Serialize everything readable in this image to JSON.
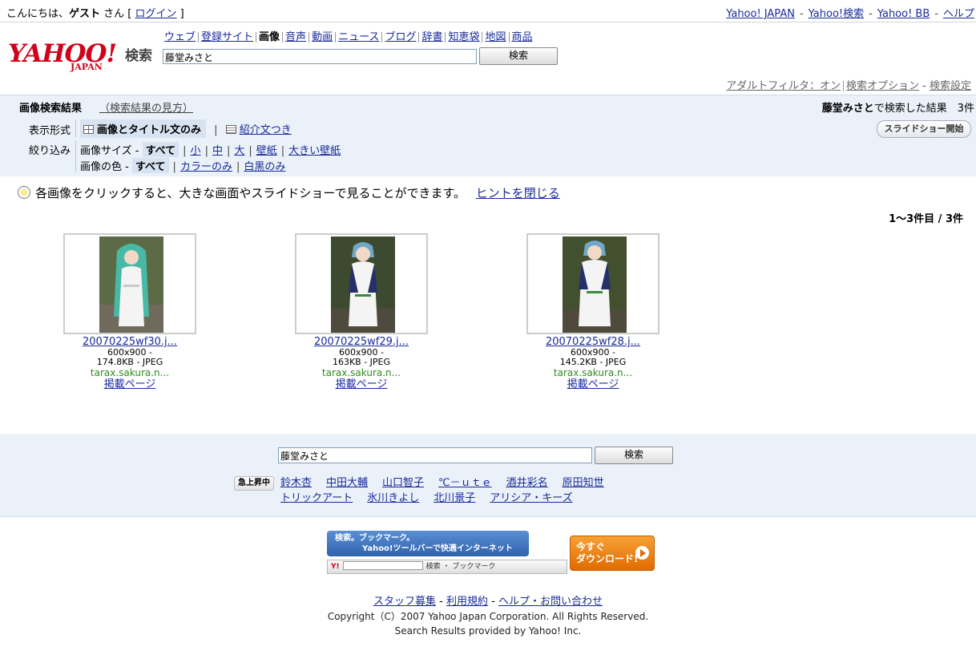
{
  "topbar": {
    "greeting_prefix": "こんにちは、",
    "guest": "ゲスト",
    "greeting_suffix": " さん [ ",
    "login": "ログイン",
    "greeting_close": " ]",
    "links": [
      "Yahoo! JAPAN",
      "Yahoo!検索",
      "Yahoo! BB",
      "ヘルプ"
    ]
  },
  "logo": {
    "yahoo": "YAHOO!",
    "japan": "JAPAN",
    "search_label": "検索"
  },
  "nav_tabs": [
    "ウェブ",
    "登録サイト",
    "画像",
    "音声",
    "動画",
    "ニュース",
    "ブログ",
    "辞書",
    "知恵袋",
    "地図",
    "商品"
  ],
  "search": {
    "query": "藤堂みさと",
    "button": "検索"
  },
  "settings": {
    "adult_filter": "アダルトフィルタ：オン",
    "options": "検索オプション",
    "prefs": "検索設定"
  },
  "results_panel": {
    "title": "画像検索結果",
    "howto": "（検索結果の見方）",
    "count_term": "藤堂みさと",
    "count_text": "で検索した結果　3件",
    "display_label": "表示形式",
    "display_grid": "画像とタイトル文のみ",
    "display_list": "紹介文つき",
    "narrow_label": "絞り込み",
    "size_label": "画像サイズ -",
    "size_options": [
      "すべて",
      "小",
      "中",
      "大",
      "壁紙",
      "大きい壁紙"
    ],
    "color_label": "画像の色 -",
    "color_options": [
      "すべて",
      "カラーのみ",
      "白黒のみ"
    ],
    "slideshow": "スライドショー開始"
  },
  "hint": {
    "text": "各画像をクリックすると、大きな画面やスライドショーで見ることができます。",
    "close": "ヒントを閉じる"
  },
  "pager": "1〜3件目 / 3件",
  "results": [
    {
      "name": "20070225wf30.j...",
      "dims": "600x900 -",
      "size": "174.8KB - JPEG",
      "host": "tarax.sakura.n...",
      "page": "掲載ページ"
    },
    {
      "name": "20070225wf29.j...",
      "dims": "600x900 -",
      "size": "163KB - JPEG",
      "host": "tarax.sakura.n...",
      "page": "掲載ページ"
    },
    {
      "name": "20070225wf28.j...",
      "dims": "600x900 -",
      "size": "145.2KB - JPEG",
      "host": "tarax.sakura.n...",
      "page": "掲載ページ"
    }
  ],
  "bottom_search": {
    "query": "藤堂みさと",
    "button": "検索"
  },
  "rising": {
    "badge": "急上昇中",
    "row1": [
      "鈴木杏",
      "中田大輔",
      "山口智子",
      "℃－ｕｔｅ",
      "酒井彩名",
      "原田知世"
    ],
    "row2": [
      "トリックアート",
      "氷川きよし",
      "北川景子",
      "アリシア・キーズ"
    ]
  },
  "ad": {
    "line1": "検索。ブックマーク。",
    "line2": "Yahoo!ツールバーで快適インターネット",
    "toolbar_text": "検索 ・ ブックマーク",
    "download1": "今すぐ",
    "download2": "ダウンロード!"
  },
  "footer": {
    "links": [
      "スタッフ募集",
      "利用規約",
      "ヘルプ・お問い合わせ"
    ],
    "copyright": "Copyright（C）2007 Yahoo Japan Corporation. All Rights Reserved.",
    "provided": "Search Results provided by Yahoo! Inc."
  }
}
